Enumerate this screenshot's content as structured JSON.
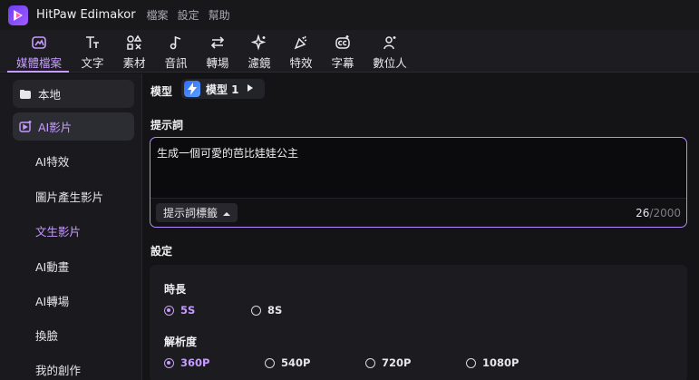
{
  "app": {
    "title": "HitPaw Edimakor",
    "menu": [
      "檔案",
      "設定",
      "幫助"
    ]
  },
  "toolbar": {
    "tabs": [
      {
        "label": "媒體檔案",
        "icon": "media-icon",
        "active": true
      },
      {
        "label": "文字",
        "icon": "text-icon",
        "active": false
      },
      {
        "label": "素材",
        "icon": "elements-icon",
        "active": false
      },
      {
        "label": "音訊",
        "icon": "audio-icon",
        "active": false
      },
      {
        "label": "轉場",
        "icon": "transition-icon",
        "active": false
      },
      {
        "label": "濾鏡",
        "icon": "filter-icon",
        "active": false
      },
      {
        "label": "特效",
        "icon": "effects-icon",
        "active": false
      },
      {
        "label": "字幕",
        "icon": "subtitle-icon",
        "active": false
      },
      {
        "label": "數位人",
        "icon": "digital-human-icon",
        "active": false
      }
    ]
  },
  "sidebar": {
    "local": "本地",
    "ai_video": "AI影片",
    "items": [
      "AI特效",
      "圖片產生影片",
      "文生影片",
      "AI動畫",
      "AI轉場",
      "換臉",
      "我的創作"
    ],
    "active_item": "文生影片"
  },
  "main": {
    "model_label": "模型",
    "model_value": "模型 1",
    "prompt_label": "提示詞",
    "prompt_text": "生成一個可愛的芭比娃娃公主",
    "tag_button": "提示詞標籤",
    "char_count": "26",
    "char_max": "/2000",
    "settings_label": "設定",
    "duration_label": "時長",
    "duration_options": [
      "5S",
      "8S"
    ],
    "duration_selected": "5S",
    "resolution_label": "解析度",
    "resolution_options": [
      "360P",
      "540P",
      "720P",
      "1080P"
    ],
    "resolution_selected": "360P"
  },
  "colors": {
    "accent": "#c79cff",
    "background": "#141417",
    "panel": "#1c1c20"
  }
}
